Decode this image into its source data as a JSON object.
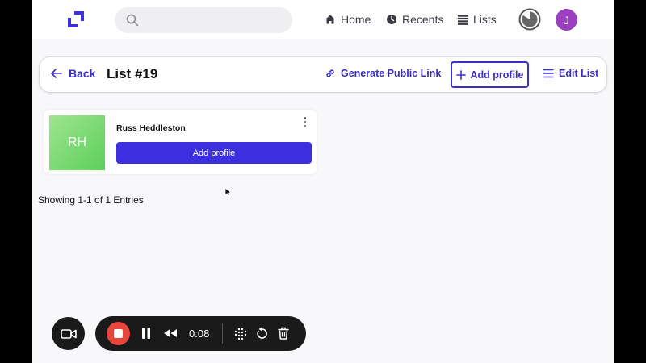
{
  "nav": {
    "home": "Home",
    "recents": "Recents",
    "lists": "Lists",
    "avatar_initial": "J"
  },
  "header": {
    "back_label": "Back",
    "title": "List #19",
    "generate_link_label": "Generate Public Link",
    "add_profile_label": "Add profile",
    "edit_list_label": "Edit List"
  },
  "profile": {
    "initials": "RH",
    "name": "Russ Heddleston",
    "button_label": "Add profile"
  },
  "pagination": {
    "summary": "Showing 1-1 of 1 Entries"
  },
  "recorder": {
    "time": "0:08"
  },
  "colors": {
    "accent": "#3b2fc9",
    "button_fill": "#3b2fe0",
    "avatar": "#9b3fbf",
    "record_stop": "#e8453c"
  }
}
